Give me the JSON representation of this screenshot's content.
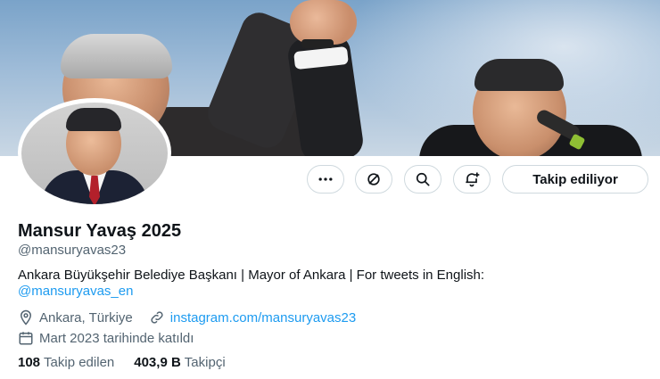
{
  "profile": {
    "display_name": "Mansur Yavaş 2025",
    "handle": "@mansuryavas23",
    "bio": "Ankara Büyükşehir Belediye Başkanı | Mayor of Ankara | For tweets in English:",
    "bio_mention": "@mansuryavas_en",
    "location": "Ankara, Türkiye",
    "website": "instagram.com/mansuryavas23",
    "joined": "Mart 2023 tarihinde katıldı"
  },
  "actions": {
    "more_icon": "more-dots-icon",
    "reply_icon": "subscribe-icon",
    "search_icon": "search-icon",
    "notify_icon": "notification-add-icon",
    "follow_label": "Takip ediliyor"
  },
  "stats": {
    "following_count": "108",
    "following_label": "Takip edilen",
    "followers_count": "403,9 B",
    "followers_label": "Takipçi"
  },
  "colors": {
    "link": "#1d9bf0",
    "secondary_text": "#536471",
    "border": "#cfd9de"
  }
}
